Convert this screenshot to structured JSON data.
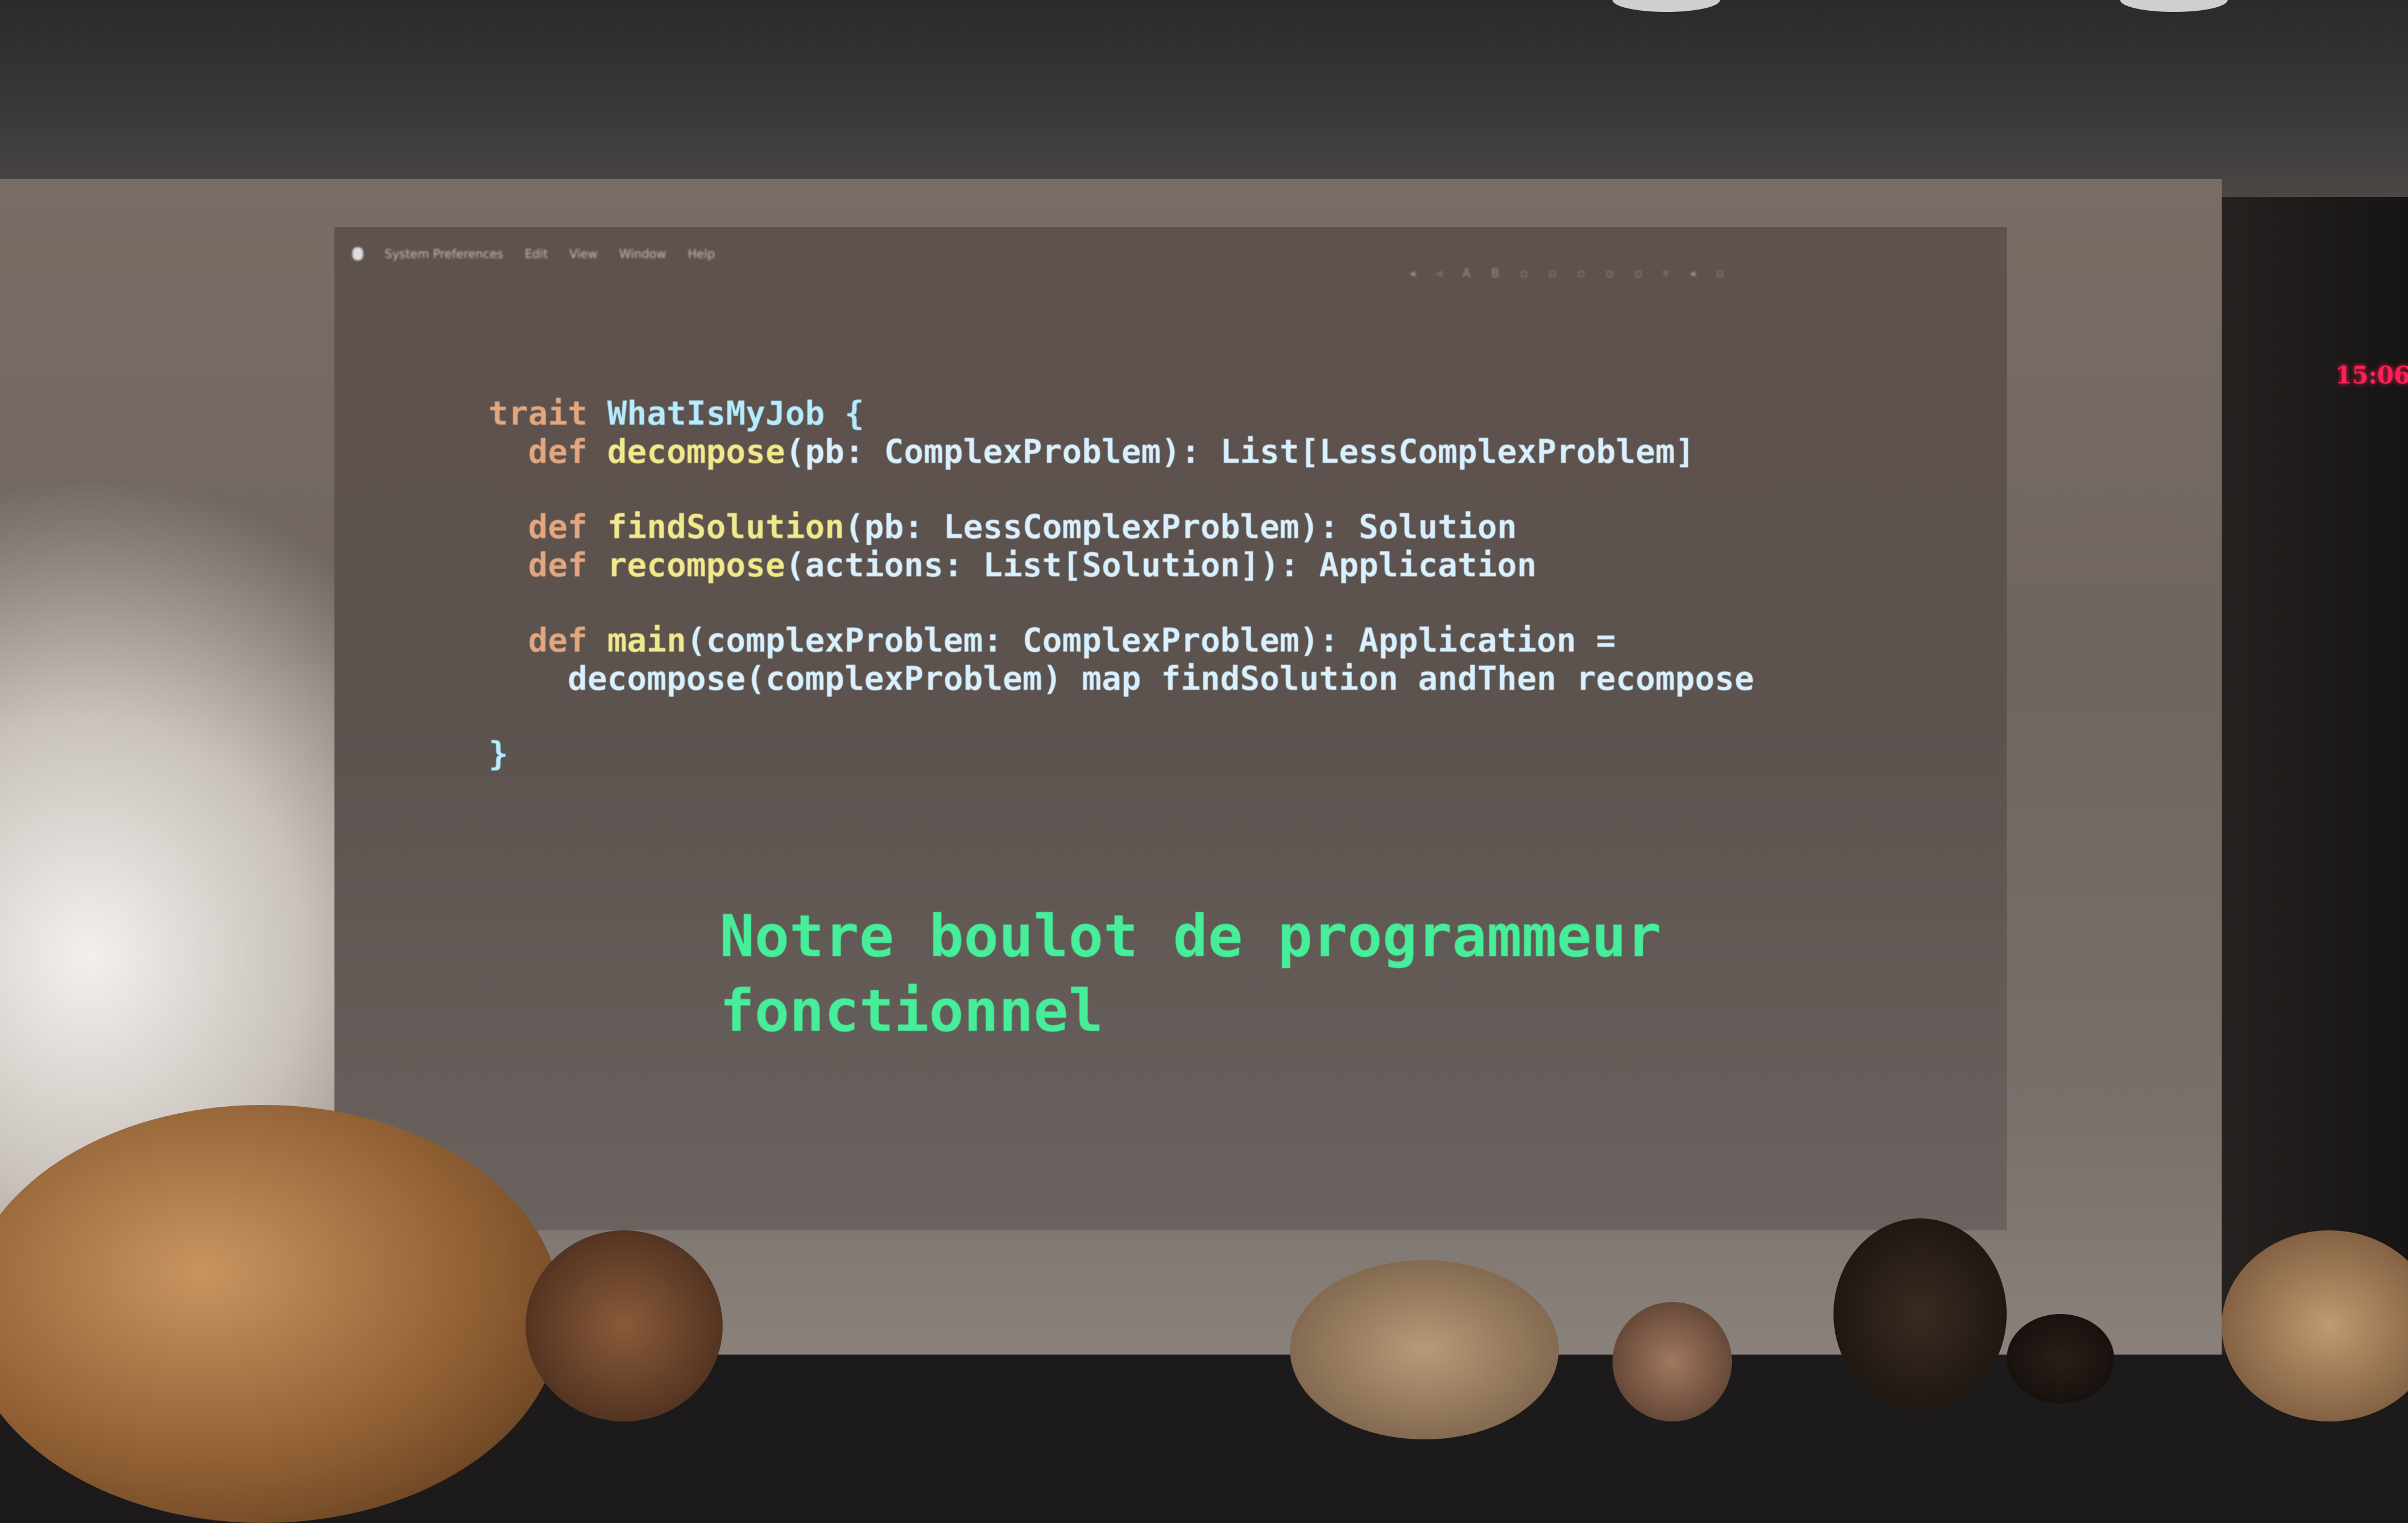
{
  "menubar": {
    "app": "System Preferences",
    "items": [
      "Edit",
      "View",
      "Window",
      "Help"
    ]
  },
  "status_icons": "◂ ◃ A B ▫ ▫ ▫ ▫ ▫ ▿ ◂ ▫",
  "code": {
    "lines": [
      [
        {
          "t": "trait ",
          "c": "kw"
        },
        {
          "t": "WhatIsMyJob {",
          "c": "ty"
        }
      ],
      [
        {
          "t": "  def ",
          "c": "kw"
        },
        {
          "t": "decompose",
          "c": "fn"
        },
        {
          "t": "(pb: ComplexProblem): List[LessComplexProblem]",
          "c": "pl"
        }
      ],
      [],
      [
        {
          "t": "  def ",
          "c": "kw"
        },
        {
          "t": "findSolution",
          "c": "fn"
        },
        {
          "t": "(pb: LessComplexProblem): Solution",
          "c": "pl"
        }
      ],
      [
        {
          "t": "  def ",
          "c": "kw"
        },
        {
          "t": "recompose",
          "c": "fn"
        },
        {
          "t": "(actions: List[Solution]): Application",
          "c": "pl"
        }
      ],
      [],
      [
        {
          "t": "  def ",
          "c": "kw"
        },
        {
          "t": "main",
          "c": "fn"
        },
        {
          "t": "(complexProblem: ComplexProblem): Application =",
          "c": "pl"
        }
      ],
      [
        {
          "t": "    decompose(complexProblem) map findSolution andThen recompose",
          "c": "pl"
        }
      ],
      [],
      [
        {
          "t": "}",
          "c": "ty"
        }
      ]
    ]
  },
  "caption": {
    "line1": "Notre boulot de programmeur",
    "line2": "fonctionnel"
  },
  "clock": "15:06"
}
